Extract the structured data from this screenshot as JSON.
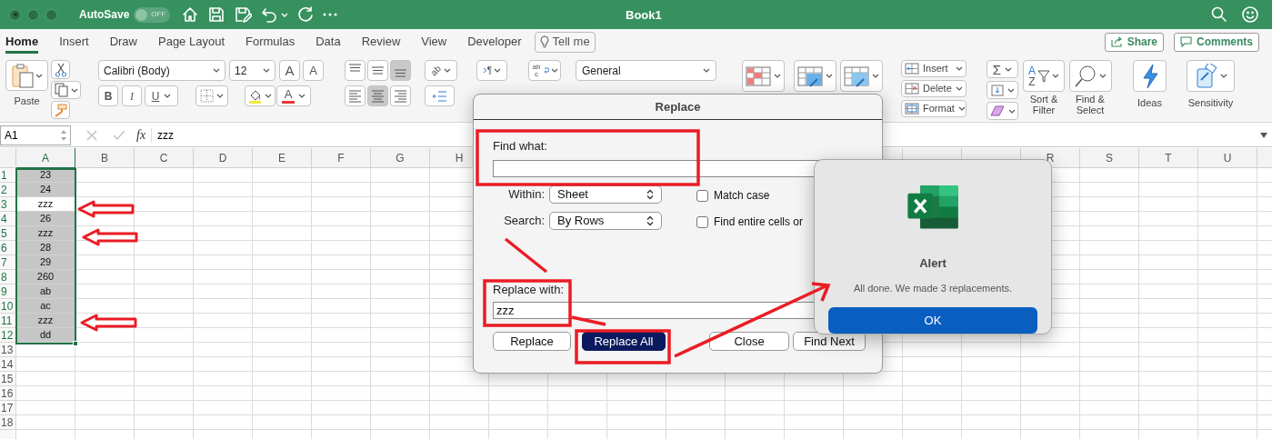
{
  "window": {
    "title": "Book1"
  },
  "autosave": {
    "label": "AutoSave",
    "on": false,
    "state_text": "OFF"
  },
  "tabs": [
    {
      "label": "Home",
      "selected": true
    },
    {
      "label": "Insert",
      "selected": false
    },
    {
      "label": "Draw",
      "selected": false
    },
    {
      "label": "Page Layout",
      "selected": false
    },
    {
      "label": "Formulas",
      "selected": false
    },
    {
      "label": "Data",
      "selected": false
    },
    {
      "label": "Review",
      "selected": false
    },
    {
      "label": "View",
      "selected": false
    },
    {
      "label": "Developer",
      "selected": false
    }
  ],
  "tell_me": "Tell me",
  "share": "Share",
  "comments": "Comments",
  "ribbon": {
    "paste": "Paste",
    "font_name": "Calibri (Body)",
    "font_size": "12",
    "grow_font": "A",
    "shrink_font": "A",
    "bold": "B",
    "italic": "I",
    "underline": "U",
    "font_color": "A",
    "align_buttons": [
      {
        "kind": "top",
        "selected": false
      },
      {
        "kind": "middle",
        "selected": false
      },
      {
        "kind": "bottom",
        "selected": true
      },
      {
        "kind": "left",
        "selected": false
      },
      {
        "kind": "center",
        "selected": true
      },
      {
        "kind": "right",
        "selected": false
      }
    ],
    "orientation": "ab",
    "text_direction": "¶",
    "wrap_text": "abc",
    "number_format": "General",
    "cells_buttons": [
      "Insert",
      "Delete",
      "Format"
    ],
    "autosum": "Σ",
    "sort_letters": [
      "A",
      "Z"
    ],
    "sort_filter": "Sort & Filter",
    "find_select": "Find & Select",
    "ideas": "Ideas",
    "sensitivity": "Sensitivity"
  },
  "formula_bar": {
    "name_box": "A1",
    "function_label": "fx",
    "value": "zzz"
  },
  "sheet": {
    "columns_left": [
      "A",
      "B",
      "C",
      "D",
      "E",
      "F",
      "G",
      "H"
    ],
    "columns_right": [
      "R",
      "S",
      "T",
      "U"
    ],
    "rows": [
      "1",
      "2",
      "3",
      "4",
      "5",
      "6",
      "7",
      "8",
      "9",
      "10",
      "11",
      "12",
      "13",
      "14",
      "15",
      "16",
      "17",
      "18"
    ],
    "cells": [
      {
        "value": "23",
        "active": false
      },
      {
        "value": "24",
        "active": false
      },
      {
        "value": "zzz",
        "active": true
      },
      {
        "value": "26",
        "active": false
      },
      {
        "value": "zzz",
        "active": false
      },
      {
        "value": "28",
        "active": false
      },
      {
        "value": "29",
        "active": false
      },
      {
        "value": "260",
        "active": false
      },
      {
        "value": "ab",
        "active": false
      },
      {
        "value": "ac",
        "active": false
      },
      {
        "value": "zzz",
        "active": false
      },
      {
        "value": "dd",
        "active": false
      }
    ]
  },
  "replace_dialog": {
    "title": "Replace",
    "find_label": "Find what:",
    "within_label": "Within:",
    "within_value": "Sheet",
    "search_label": "Search:",
    "search_value": "By Rows",
    "options": [
      {
        "label": "Match case",
        "checked": false
      },
      {
        "label": "Find entire cells or",
        "checked": false
      }
    ],
    "replace_label": "Replace with:",
    "replace_value": "zzz",
    "buttons": [
      {
        "label": "Replace",
        "default": false
      },
      {
        "label": "Replace All",
        "default": true
      },
      {
        "label": "Close",
        "default": false
      },
      {
        "label": "Find Next",
        "default": false
      }
    ]
  },
  "alert": {
    "title": "Alert",
    "message": "All done. We made 3 replacements.",
    "button": "OK"
  }
}
